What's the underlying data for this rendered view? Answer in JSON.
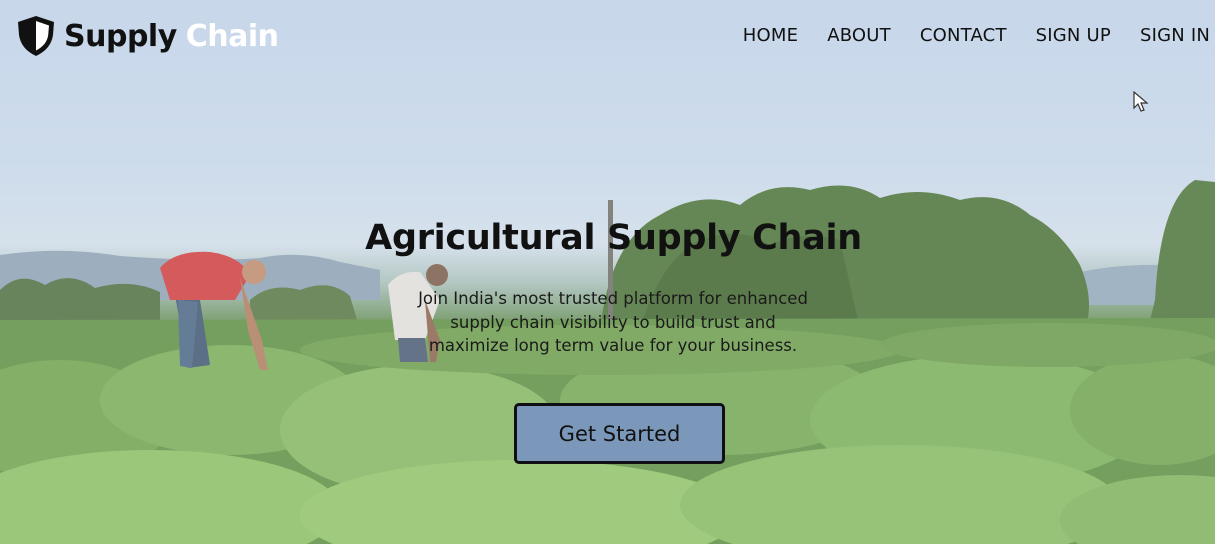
{
  "header": {
    "logo_word_1": "Supply",
    "logo_word_2": "Chain",
    "logo_icon": "shield-icon"
  },
  "nav": {
    "items": [
      "HOME",
      "ABOUT",
      "CONTACT",
      "SIGN UP",
      "SIGN IN"
    ]
  },
  "hero": {
    "title": "Agricultural Supply Chain",
    "subtitle": "Join India's most trusted platform for enhanced supply chain visibility to build trust and maximize long term value for your business.",
    "cta_label": "Get Started",
    "background": "farm-field-photo"
  },
  "colors": {
    "logo_dark": "#111111",
    "logo_light": "#ffffff",
    "cta_background": "#7b98ba",
    "cta_border": "#0f0f14",
    "text": "#111111"
  },
  "cursor": "pointer-arrow-icon"
}
